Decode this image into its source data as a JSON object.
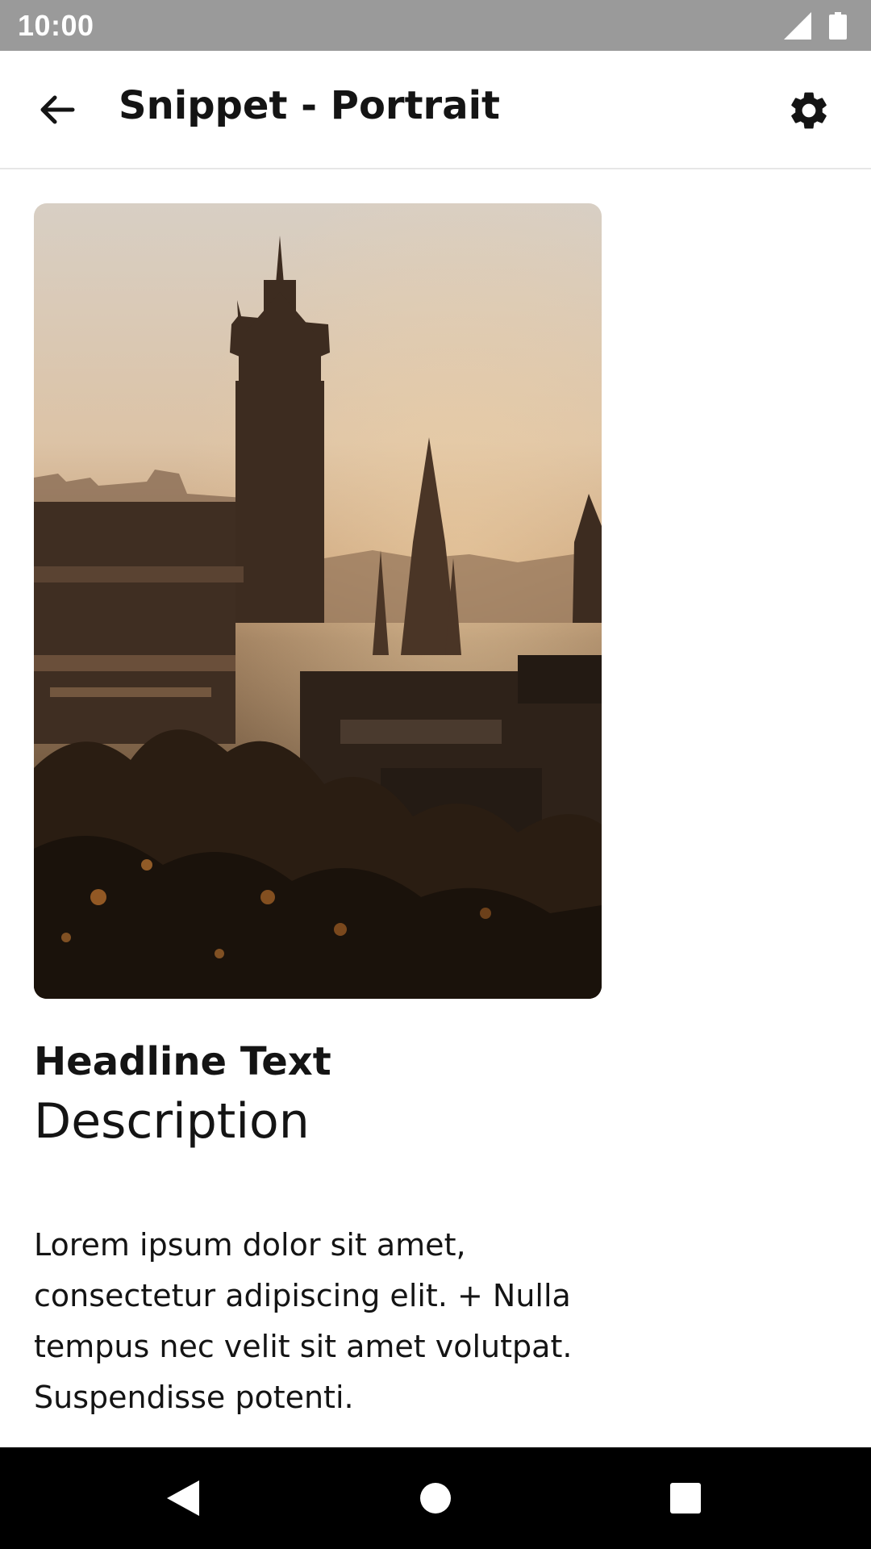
{
  "status_bar": {
    "time": "10:00",
    "icons": [
      "cellular-signal-icon",
      "battery-icon"
    ],
    "background": "#9a9a9a"
  },
  "app_bar": {
    "title": "Snippet - Portrait",
    "back_icon": "arrow-back-icon",
    "settings_icon": "gear-icon"
  },
  "card": {
    "image": "city-skyline-sunset-photo",
    "headline": "Headline Text",
    "description": "Description",
    "body": "Lorem ipsum dolor sit amet, consectetur adipiscing elit. + Nulla tempus nec velit sit amet volutpat. Suspendisse potenti."
  },
  "nav_bar": {
    "buttons": [
      "back-triangle-icon",
      "home-circle-icon",
      "recents-square-icon"
    ]
  }
}
